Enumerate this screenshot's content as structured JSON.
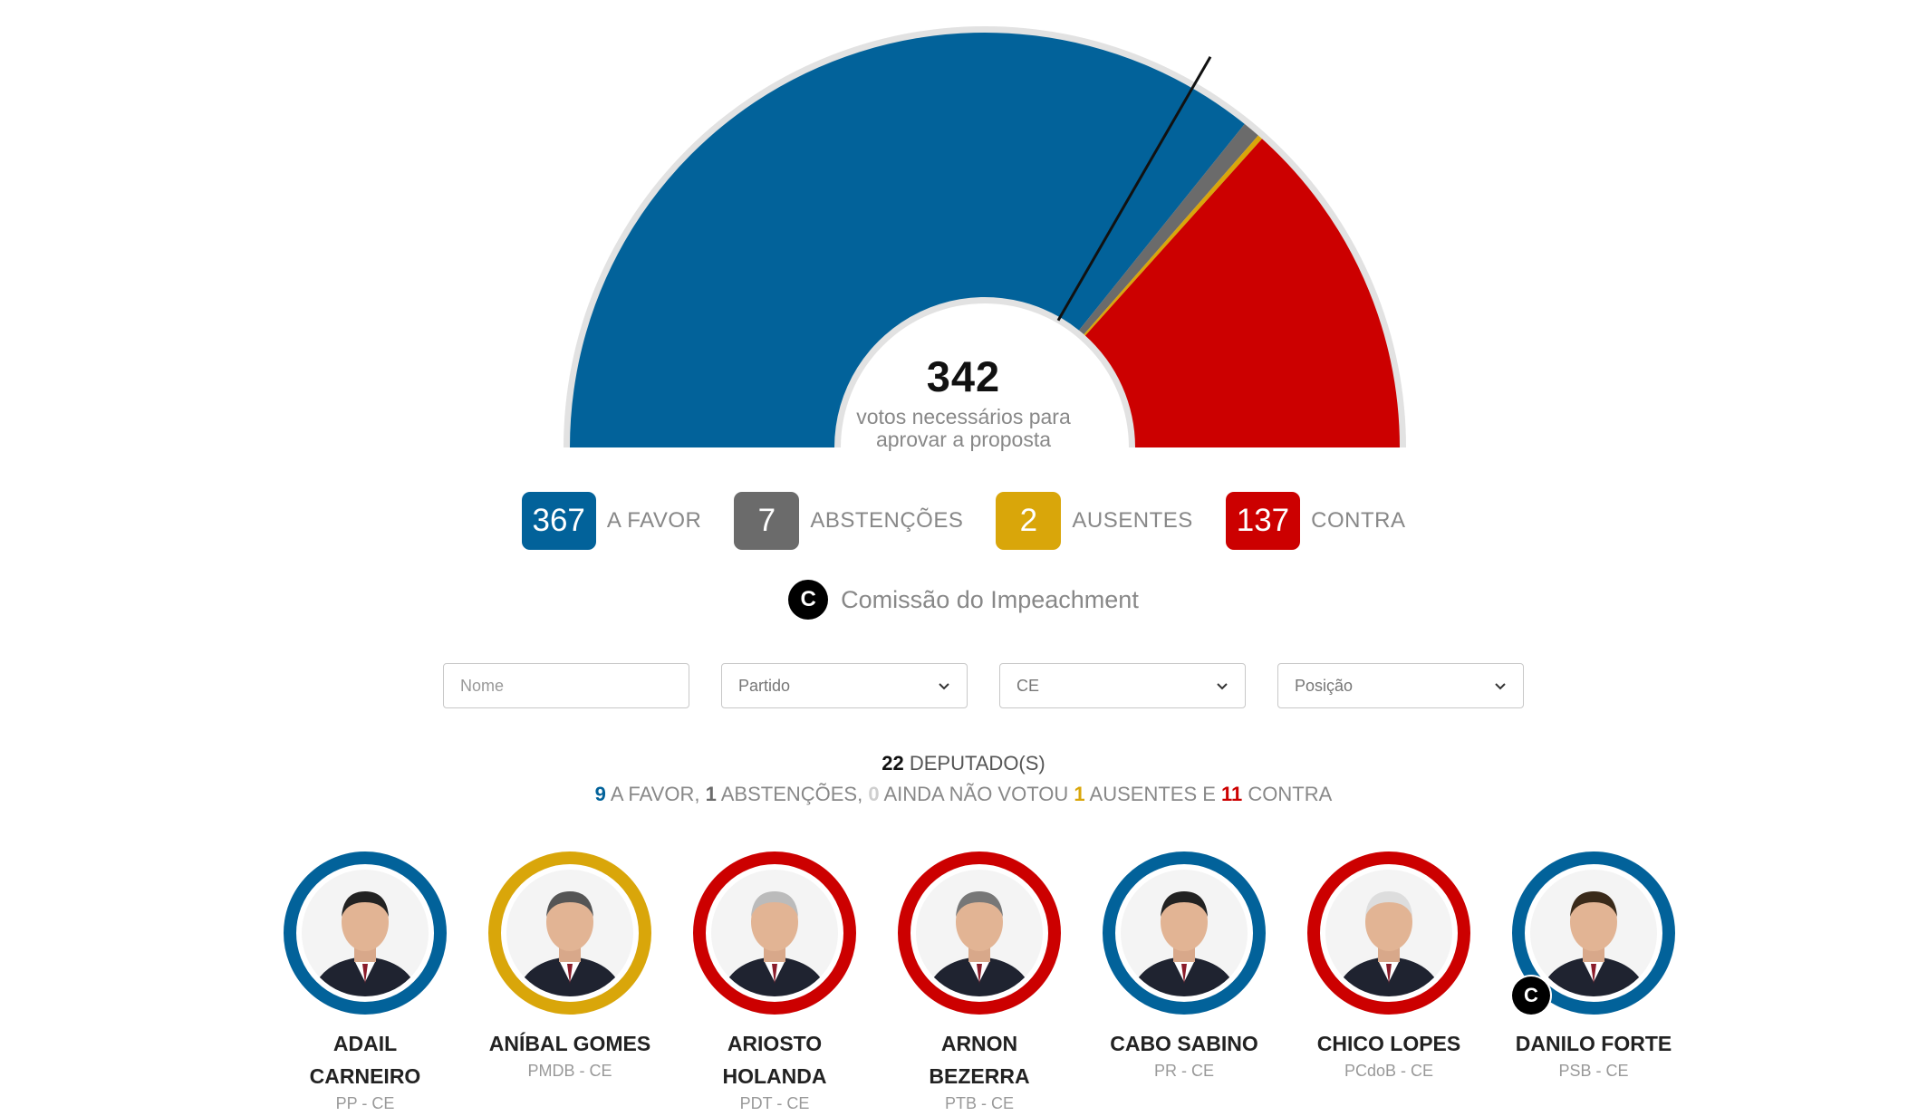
{
  "colors": {
    "favor": "#02629a",
    "abstencoes": "#6b6b6b",
    "ausentes": "#d9a60a",
    "contra": "#cc0000",
    "outline": "#e2e2e2"
  },
  "chart_data": {
    "type": "pie",
    "series": [
      {
        "name": "A FAVOR",
        "value": 367,
        "color": "#02629a"
      },
      {
        "name": "ABSTENÇÕES",
        "value": 7,
        "color": "#6b6b6b"
      },
      {
        "name": "AUSENTES",
        "value": 2,
        "color": "#d9a60a"
      },
      {
        "name": "CONTRA",
        "value": 137,
        "color": "#cc0000"
      }
    ],
    "threshold": 342,
    "total": 513
  },
  "center": {
    "count": "342",
    "line1": "votos necessários para",
    "line2": "aprovar a proposta"
  },
  "legend": [
    {
      "value": "367",
      "label": "A FAVOR",
      "color": "#02629a"
    },
    {
      "value": "7",
      "label": "ABSTENÇÕES",
      "color": "#6b6b6b"
    },
    {
      "value": "2",
      "label": "AUSENTES",
      "color": "#d9a60a"
    },
    {
      "value": "137",
      "label": "CONTRA",
      "color": "#cc0000"
    }
  ],
  "commission": {
    "badge": "C",
    "label": "Comissão do Impeachment"
  },
  "filters": {
    "name_placeholder": "Nome",
    "partido": "Partido",
    "estado": "CE",
    "posicao": "Posição"
  },
  "summary": {
    "total": "22",
    "total_label": "DEPUTADO(S)",
    "favor_count": "9",
    "favor_label": "A FAVOR,",
    "abst_count": "1",
    "abst_label": "ABSTENÇÕES,",
    "nv_count": "0",
    "nv_label": "AINDA NÃO VOTOU",
    "aus_count": "1",
    "aus_label": "AUSENTES E",
    "contra_count": "11",
    "contra_label": "CONTRA"
  },
  "deputies": [
    {
      "name": "ADAIL CARNEIRO",
      "party": "PP - CE",
      "vote": "favor",
      "ring": "#02629a",
      "commission": false
    },
    {
      "name": "ANÍBAL GOMES",
      "party": "PMDB - CE",
      "vote": "ausente",
      "ring": "#d9a60a",
      "commission": false
    },
    {
      "name": "ARIOSTO HOLANDA",
      "party": "PDT - CE",
      "vote": "contra",
      "ring": "#cc0000",
      "commission": false
    },
    {
      "name": "ARNON BEZERRA",
      "party": "PTB - CE",
      "vote": "contra",
      "ring": "#cc0000",
      "commission": false
    },
    {
      "name": "CABO SABINO",
      "party": "PR - CE",
      "vote": "favor",
      "ring": "#02629a",
      "commission": false
    },
    {
      "name": "CHICO LOPES",
      "party": "PCdoB - CE",
      "vote": "contra",
      "ring": "#cc0000",
      "commission": false
    },
    {
      "name": "DANILO FORTE",
      "party": "PSB - CE",
      "vote": "favor",
      "ring": "#02629a",
      "commission": true
    }
  ]
}
